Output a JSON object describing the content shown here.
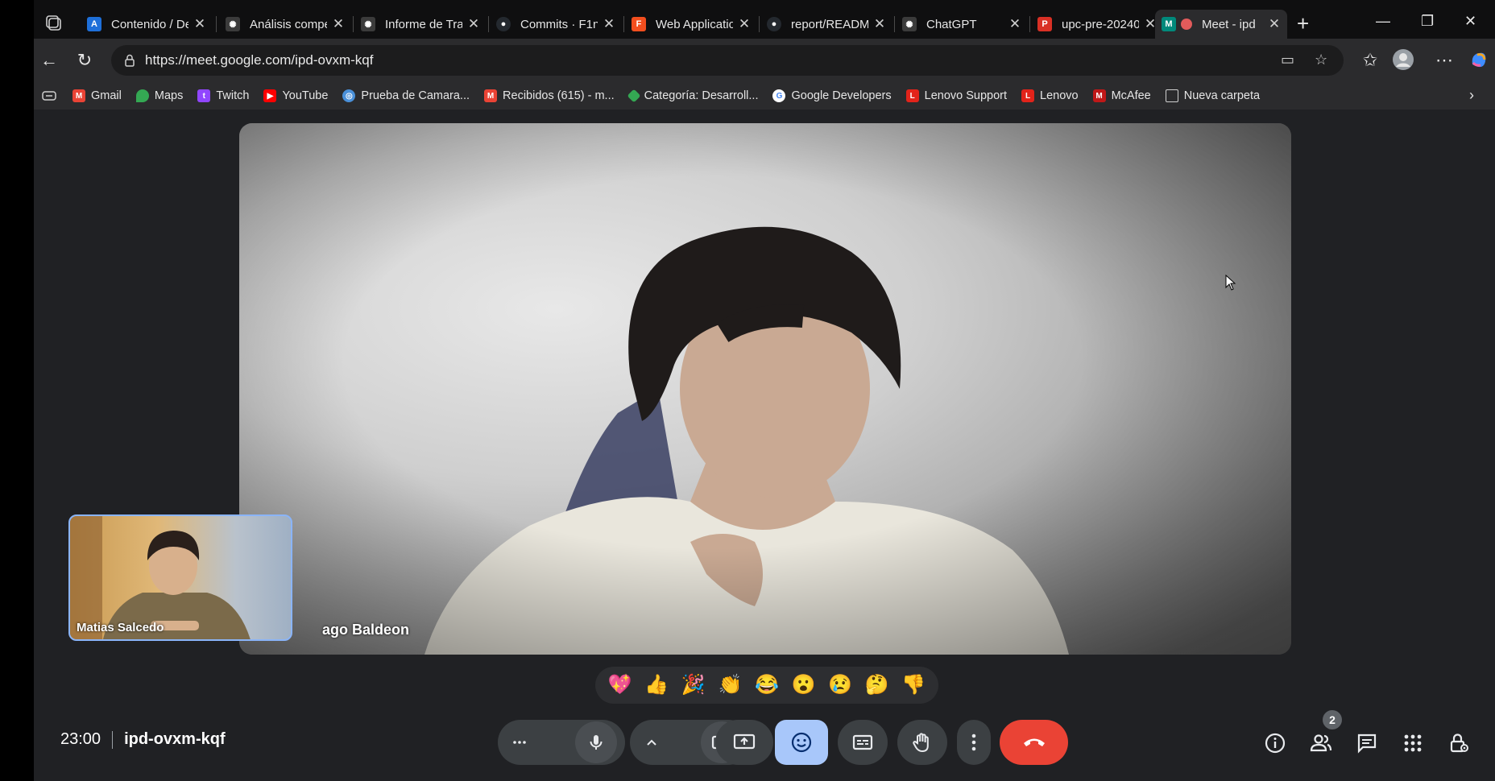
{
  "browser": {
    "tabs": [
      {
        "title": "Contenido / De",
        "favicon": "azure-devops-icon",
        "color": "#1e6fd9"
      },
      {
        "title": "Análisis compe",
        "favicon": "openai-icon",
        "color": "#3b3b3b"
      },
      {
        "title": "Informe de Tra",
        "favicon": "openai-icon",
        "color": "#3b3b3b"
      },
      {
        "title": "Commits · F1n",
        "favicon": "github-icon",
        "color": "#24292f"
      },
      {
        "title": "Web Applicatio",
        "favicon": "figma-icon",
        "color": "#f24e1e"
      },
      {
        "title": "report/READM",
        "favicon": "github-icon",
        "color": "#24292f"
      },
      {
        "title": "ChatGPT",
        "favicon": "openai-icon",
        "color": "#3b3b3b"
      },
      {
        "title": "upc-pre-20240",
        "favicon": "pdf-icon",
        "color": "#d93025"
      },
      {
        "title": "Meet - ipd",
        "favicon": "google-meet-icon",
        "color": "#00897b",
        "active": true
      }
    ],
    "url": "https://meet.google.com/ipd-ovxm-kqf",
    "bookmarks": [
      {
        "label": "Gmail",
        "icon": "gmail-icon",
        "color": "#ea4335"
      },
      {
        "label": "Maps",
        "icon": "maps-icon",
        "color": "#34a853"
      },
      {
        "label": "Twitch",
        "icon": "twitch-icon",
        "color": "#9146ff"
      },
      {
        "label": "YouTube",
        "icon": "youtube-icon",
        "color": "#ff0000"
      },
      {
        "label": "Prueba de Camara...",
        "icon": "camera-test-icon",
        "color": "#4a90d9"
      },
      {
        "label": "Recibidos (615) - m...",
        "icon": "gmail-icon",
        "color": "#ea4335"
      },
      {
        "label": "Categoría: Desarroll...",
        "icon": "diamond-icon",
        "color": "#34a853"
      },
      {
        "label": "Google Developers",
        "icon": "google-icon",
        "color": "#4285f4"
      },
      {
        "label": "Lenovo Support",
        "icon": "lenovo-icon",
        "color": "#e2231a"
      },
      {
        "label": "Lenovo",
        "icon": "lenovo-icon",
        "color": "#e2231a"
      },
      {
        "label": "McAfee",
        "icon": "mcafee-icon",
        "color": "#c01818"
      },
      {
        "label": "Nueva carpeta",
        "icon": "folder-icon",
        "color": "#cfcfcf"
      }
    ]
  },
  "meet": {
    "main_participant_name": "ago Baldeon",
    "self_name": "Matias Salcedo",
    "reactions": [
      "💖",
      "👍",
      "🎉",
      "👏",
      "😂",
      "😮",
      "😢",
      "🤔",
      "👎"
    ],
    "time": "23:00",
    "meeting_code": "ipd-ovxm-kqf",
    "participant_count": "2",
    "colors": {
      "accent": "#a8c7fa",
      "end_call": "#ea4335",
      "control": "#3c4043"
    }
  }
}
